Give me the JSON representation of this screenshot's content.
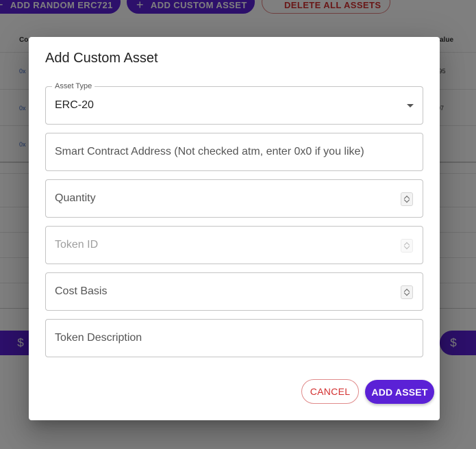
{
  "background": {
    "toolbar": {
      "add_random_label": "ADD RANDOM ERC721",
      "add_custom_label": "ADD CUSTOM ASSET",
      "delete_all_label": "DELETE ALL ASSETS"
    },
    "table": {
      "col_first_header": "Co",
      "col_last_header": "alue",
      "rows": [
        {
          "link": "0x",
          "value": ".95"
        },
        {
          "link": "0x",
          "value": "07"
        },
        {
          "link": "0x",
          "value": ""
        }
      ]
    },
    "pill_icon": "$"
  },
  "dialog": {
    "title": "Add Custom Asset",
    "asset_type": {
      "label": "Asset Type",
      "value": "ERC-20"
    },
    "contract_address": {
      "placeholder": "Smart Contract Address (Not checked atm, enter 0x0 if you like)"
    },
    "quantity": {
      "placeholder": "Quantity"
    },
    "token_id": {
      "placeholder": "Token ID"
    },
    "cost_basis": {
      "placeholder": "Cost Basis"
    },
    "token_description": {
      "placeholder": "Token Description"
    },
    "cancel_label": "CANCEL",
    "add_label": "ADD ASSET"
  },
  "colors": {
    "primary": "#5b21d6",
    "danger": "#d32f2f"
  }
}
